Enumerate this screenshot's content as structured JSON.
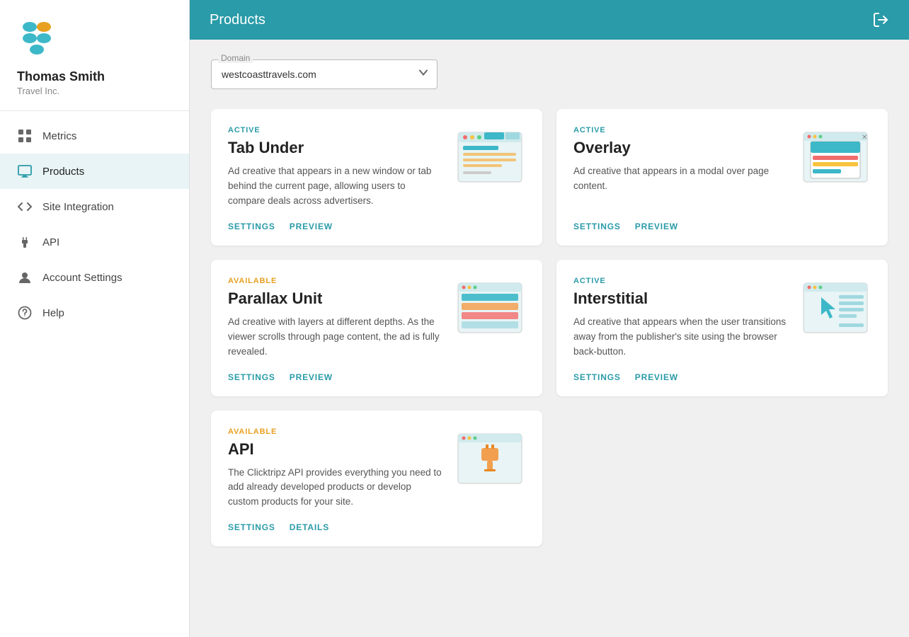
{
  "sidebar": {
    "user": {
      "name": "Thomas Smith",
      "company": "Travel Inc."
    },
    "nav_items": [
      {
        "id": "metrics",
        "label": "Metrics",
        "icon": "grid-icon",
        "active": false
      },
      {
        "id": "products",
        "label": "Products",
        "icon": "monitor-icon",
        "active": true
      },
      {
        "id": "site-integration",
        "label": "Site Integration",
        "icon": "code-icon",
        "active": false
      },
      {
        "id": "api",
        "label": "API",
        "icon": "plug-icon",
        "active": false
      },
      {
        "id": "account-settings",
        "label": "Account Settings",
        "icon": "person-icon",
        "active": false
      },
      {
        "id": "help",
        "label": "Help",
        "icon": "question-icon",
        "active": false
      }
    ]
  },
  "header": {
    "title": "Products"
  },
  "domain": {
    "label": "Domain",
    "value": "westcoasttravels.com",
    "options": [
      "westcoasttravels.com"
    ]
  },
  "products": [
    {
      "id": "tab-under",
      "status": "ACTIVE",
      "status_type": "active",
      "title": "Tab Under",
      "description": "Ad creative that appears in a new window or tab behind the current page, allowing users to compare deals across advertisers.",
      "actions": [
        {
          "label": "SETTINGS",
          "id": "settings"
        },
        {
          "label": "PREVIEW",
          "id": "preview"
        }
      ]
    },
    {
      "id": "overlay",
      "status": "ACTIVE",
      "status_type": "active",
      "title": "Overlay",
      "description": "Ad creative that appears in a modal over page content.",
      "actions": [
        {
          "label": "SETTINGS",
          "id": "settings"
        },
        {
          "label": "PREVIEW",
          "id": "preview"
        }
      ]
    },
    {
      "id": "parallax-unit",
      "status": "AVAILABLE",
      "status_type": "available",
      "title": "Parallax Unit",
      "description": "Ad creative with layers at different depths. As the viewer scrolls through page content, the ad is fully revealed.",
      "actions": [
        {
          "label": "SETTINGS",
          "id": "settings"
        },
        {
          "label": "PREVIEW",
          "id": "preview"
        }
      ]
    },
    {
      "id": "interstitial",
      "status": "ACTIVE",
      "status_type": "active",
      "title": "Interstitial",
      "description": "Ad creative that appears when the user transitions away from the publisher's site using the browser back-button.",
      "actions": [
        {
          "label": "SETTINGS",
          "id": "settings"
        },
        {
          "label": "PREVIEW",
          "id": "preview"
        }
      ]
    },
    {
      "id": "api",
      "status": "AVAILABLE",
      "status_type": "available",
      "title": "API",
      "description": "The Clicktripz API provides everything you need to add already developed products or develop custom products for your site.",
      "actions": [
        {
          "label": "SETTINGS",
          "id": "settings"
        },
        {
          "label": "DETAILS",
          "id": "details"
        }
      ]
    }
  ],
  "logout_icon": "→"
}
